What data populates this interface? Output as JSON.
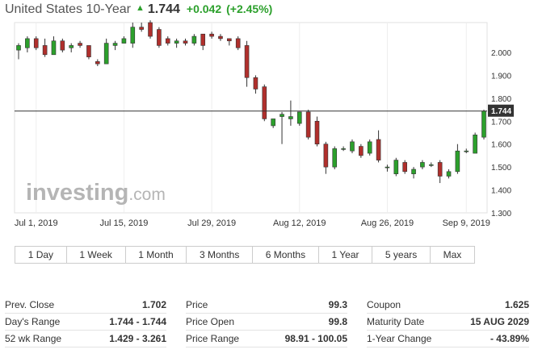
{
  "header": {
    "title": "United States 10-Year",
    "last": "1.744",
    "change": "+0.042",
    "change_pct": "(+2.45%)",
    "up_color": "#2ca02c",
    "down_color": "#b02f2c"
  },
  "watermark": {
    "brand": "investing",
    "suffix": ".com"
  },
  "ranges": [
    {
      "label": "1 Day"
    },
    {
      "label": "1 Week"
    },
    {
      "label": "1 Month"
    },
    {
      "label": "3 Months"
    },
    {
      "label": "6 Months"
    },
    {
      "label": "1 Year"
    },
    {
      "label": "5 years"
    },
    {
      "label": "Max"
    }
  ],
  "stats": {
    "col1": [
      {
        "label": "Prev. Close",
        "value": "1.702"
      },
      {
        "label": "Day's Range",
        "value": "1.744 - 1.744"
      },
      {
        "label": "52 wk Range",
        "value": "1.429 - 3.261"
      }
    ],
    "col2": [
      {
        "label": "Price",
        "value": "99.3"
      },
      {
        "label": "Price Open",
        "value": "99.8"
      },
      {
        "label": "Price Range",
        "value": "98.91 - 100.05"
      }
    ],
    "col3": [
      {
        "label": "Coupon",
        "value": "1.625"
      },
      {
        "label": "Maturity Date",
        "value": "15 AUG 2029"
      },
      {
        "label": "1-Year Change",
        "value": "- 43.89%"
      }
    ]
  },
  "chart_data": {
    "type": "candlestick",
    "ylim": [
      1.3,
      2.13
    ],
    "y_ticks": [
      "2.000",
      "1.900",
      "1.800",
      "1.700",
      "1.600",
      "1.500",
      "1.400",
      "1.300"
    ],
    "x_ticks": [
      {
        "label": "Jul 1, 2019",
        "index": 2
      },
      {
        "label": "Jul 15, 2019",
        "index": 12
      },
      {
        "label": "Jul 29, 2019",
        "index": 22
      },
      {
        "label": "Aug 12, 2019",
        "index": 32
      },
      {
        "label": "Aug 26, 2019",
        "index": 42
      },
      {
        "label": "Sep 9, 2019",
        "index": 51
      }
    ],
    "current_price": 1.744,
    "current_label": "1.744",
    "grid": "vertical",
    "up_color": "#2ca02c",
    "down_color": "#b02f2c",
    "candles": [
      {
        "o": 2.01,
        "h": 2.04,
        "l": 1.97,
        "c": 2.03
      },
      {
        "o": 2.02,
        "h": 2.07,
        "l": 2.0,
        "c": 2.06
      },
      {
        "o": 2.06,
        "h": 2.07,
        "l": 2.01,
        "c": 2.02
      },
      {
        "o": 2.03,
        "h": 2.06,
        "l": 1.98,
        "c": 1.99
      },
      {
        "o": 1.99,
        "h": 2.07,
        "l": 1.99,
        "c": 2.05
      },
      {
        "o": 2.05,
        "h": 2.06,
        "l": 2.0,
        "c": 2.01
      },
      {
        "o": 2.02,
        "h": 2.04,
        "l": 2.0,
        "c": 2.03
      },
      {
        "o": 2.04,
        "h": 2.05,
        "l": 2.02,
        "c": 2.03
      },
      {
        "o": 2.03,
        "h": 2.03,
        "l": 1.97,
        "c": 1.98
      },
      {
        "o": 1.96,
        "h": 1.97,
        "l": 1.94,
        "c": 1.95
      },
      {
        "o": 1.95,
        "h": 2.06,
        "l": 1.95,
        "c": 2.04
      },
      {
        "o": 2.03,
        "h": 2.05,
        "l": 2.01,
        "c": 2.04
      },
      {
        "o": 2.04,
        "h": 2.07,
        "l": 2.04,
        "c": 2.06
      },
      {
        "o": 2.04,
        "h": 2.13,
        "l": 2.02,
        "c": 2.11
      },
      {
        "o": 2.11,
        "h": 2.13,
        "l": 2.09,
        "c": 2.1
      },
      {
        "o": 2.13,
        "h": 2.14,
        "l": 2.06,
        "c": 2.07
      },
      {
        "o": 2.1,
        "h": 2.11,
        "l": 2.02,
        "c": 2.03
      },
      {
        "o": 2.06,
        "h": 2.07,
        "l": 2.03,
        "c": 2.04
      },
      {
        "o": 2.04,
        "h": 2.06,
        "l": 2.02,
        "c": 2.05
      },
      {
        "o": 2.05,
        "h": 2.06,
        "l": 2.03,
        "c": 2.04
      },
      {
        "o": 2.04,
        "h": 2.08,
        "l": 2.03,
        "c": 2.07
      },
      {
        "o": 2.08,
        "h": 2.08,
        "l": 2.01,
        "c": 2.03
      },
      {
        "o": 2.08,
        "h": 2.09,
        "l": 2.06,
        "c": 2.07
      },
      {
        "o": 2.07,
        "h": 2.08,
        "l": 2.05,
        "c": 2.06
      },
      {
        "o": 2.06,
        "h": 2.06,
        "l": 2.03,
        "c": 2.05
      },
      {
        "o": 2.06,
        "h": 2.07,
        "l": 2.01,
        "c": 2.02
      },
      {
        "o": 2.03,
        "h": 2.05,
        "l": 1.85,
        "c": 1.89
      },
      {
        "o": 1.89,
        "h": 1.9,
        "l": 1.82,
        "c": 1.84
      },
      {
        "o": 1.85,
        "h": 1.86,
        "l": 1.7,
        "c": 1.71
      },
      {
        "o": 1.68,
        "h": 1.71,
        "l": 1.67,
        "c": 1.71
      },
      {
        "o": 1.72,
        "h": 1.74,
        "l": 1.6,
        "c": 1.73
      },
      {
        "o": 1.71,
        "h": 1.79,
        "l": 1.68,
        "c": 1.72
      },
      {
        "o": 1.69,
        "h": 1.74,
        "l": 1.68,
        "c": 1.74
      },
      {
        "o": 1.74,
        "h": 1.75,
        "l": 1.62,
        "c": 1.63
      },
      {
        "o": 1.7,
        "h": 1.72,
        "l": 1.59,
        "c": 1.6
      },
      {
        "o": 1.6,
        "h": 1.61,
        "l": 1.47,
        "c": 1.5
      },
      {
        "o": 1.5,
        "h": 1.59,
        "l": 1.49,
        "c": 1.58
      },
      {
        "o": 1.58,
        "h": 1.59,
        "l": 1.57,
        "c": 1.58
      },
      {
        "o": 1.57,
        "h": 1.62,
        "l": 1.56,
        "c": 1.61
      },
      {
        "o": 1.59,
        "h": 1.6,
        "l": 1.54,
        "c": 1.55
      },
      {
        "o": 1.56,
        "h": 1.62,
        "l": 1.55,
        "c": 1.61
      },
      {
        "o": 1.62,
        "h": 1.66,
        "l": 1.52,
        "c": 1.53
      },
      {
        "o": 1.5,
        "h": 1.51,
        "l": 1.48,
        "c": 1.5
      },
      {
        "o": 1.47,
        "h": 1.54,
        "l": 1.46,
        "c": 1.53
      },
      {
        "o": 1.52,
        "h": 1.53,
        "l": 1.47,
        "c": 1.48
      },
      {
        "o": 1.47,
        "h": 1.5,
        "l": 1.45,
        "c": 1.49
      },
      {
        "o": 1.5,
        "h": 1.53,
        "l": 1.49,
        "c": 1.52
      },
      {
        "o": 1.51,
        "h": 1.52,
        "l": 1.5,
        "c": 1.51
      },
      {
        "o": 1.52,
        "h": 1.53,
        "l": 1.43,
        "c": 1.46
      },
      {
        "o": 1.46,
        "h": 1.49,
        "l": 1.45,
        "c": 1.48
      },
      {
        "o": 1.48,
        "h": 1.6,
        "l": 1.47,
        "c": 1.57
      },
      {
        "o": 1.57,
        "h": 1.58,
        "l": 1.56,
        "c": 1.57
      },
      {
        "o": 1.56,
        "h": 1.65,
        "l": 1.56,
        "c": 1.64
      },
      {
        "o": 1.63,
        "h": 1.75,
        "l": 1.62,
        "c": 1.744
      }
    ]
  },
  "stat_labels_unused": ""
}
